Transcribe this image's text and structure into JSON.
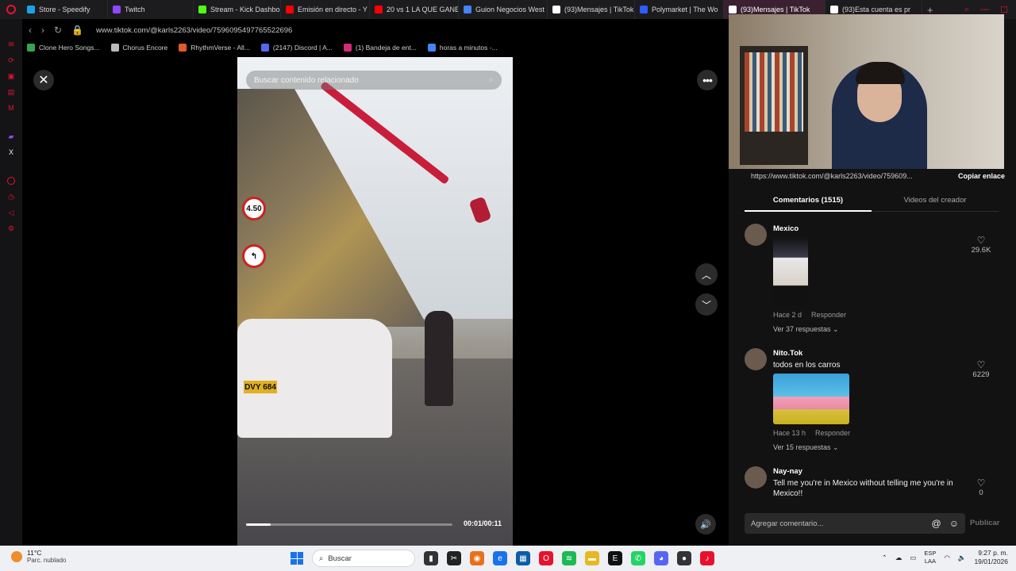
{
  "browser": {
    "tabs": [
      {
        "label": "Store - Speedify",
        "color": "#1aa3e8",
        "active": false
      },
      {
        "label": "Twitch",
        "color": "#9146ff",
        "active": false
      },
      {
        "label": "Stream - Kick Dashbo",
        "color": "#53fc18",
        "active": false
      },
      {
        "label": "Emisión en directo - Y",
        "color": "#ff0000",
        "active": false
      },
      {
        "label": "20 vs 1 LA QUE GANE",
        "color": "#ff0000",
        "active": false
      },
      {
        "label": "Guion Negocios West",
        "color": "#4285f4",
        "active": false
      },
      {
        "label": "(93)Mensajes | TikTok",
        "color": "#ffffff",
        "active": false
      },
      {
        "label": "Polymarket | The Wo",
        "color": "#2e5cff",
        "active": false
      },
      {
        "label": "(93)Mensajes | TikTok",
        "color": "#ffffff",
        "active": true
      },
      {
        "label": "(93)Esta cuenta es pr",
        "color": "#ffffff",
        "active": false
      }
    ],
    "new_tab_glyph": "+",
    "url": "www.tiktok.com/@karls2263/video/7596095497765522696",
    "bookmarks": [
      {
        "label": "Clone Hero Songs...",
        "color": "#3aa34a"
      },
      {
        "label": "Chorus Encore",
        "color": "#bbbbbb"
      },
      {
        "label": "RhythmVerse - All...",
        "color": "#e05a2a"
      },
      {
        "label": "(2147) Discord | A...",
        "color": "#5865f2"
      },
      {
        "label": "(1) Bandeja de ent...",
        "color": "#d62976"
      },
      {
        "label": "horas a minutos -...",
        "color": "#4285f4"
      }
    ]
  },
  "video": {
    "search_placeholder": "Buscar contenido relacionado",
    "time": "00:01/00:11",
    "progress_fraction": 0.12,
    "plate": "DVY 684",
    "sign_text": "4.50"
  },
  "panel": {
    "share_link": "https://www.tiktok.com/@karls2263/video/759609...",
    "copy_link_label": "Copiar enlace",
    "tabs": [
      "Comentarios (1515)",
      "Videos del creador"
    ],
    "comments": [
      {
        "user": "Mexico",
        "text": "",
        "time": "Hace 2 d",
        "reply": "Responder",
        "replies": "Ver 37 respuestas ⌄",
        "likes": "29.6K",
        "image": "cimg1"
      },
      {
        "user": "Nito.Tok",
        "text": "todos en los carros",
        "time": "Hace 13 h",
        "reply": "Responder",
        "replies": "Ver 15 respuestas ⌄",
        "likes": "6229",
        "image": "cimg2"
      },
      {
        "user": "Nay-nay",
        "text": "Tell me you're in Mexico without telling me you're in Mexico!!",
        "time": "",
        "reply": "",
        "replies": "",
        "likes": "0",
        "image": ""
      }
    ],
    "input_placeholder": "Agregar comentario...",
    "publish_label": "Publicar"
  },
  "taskbar": {
    "temp": "11°C",
    "weather": "Parc. nublado",
    "search_label": "Buscar",
    "lang1": "ESP",
    "lang2": "LAA",
    "time": "9:27 p. m.",
    "date": "19/01/2026"
  }
}
